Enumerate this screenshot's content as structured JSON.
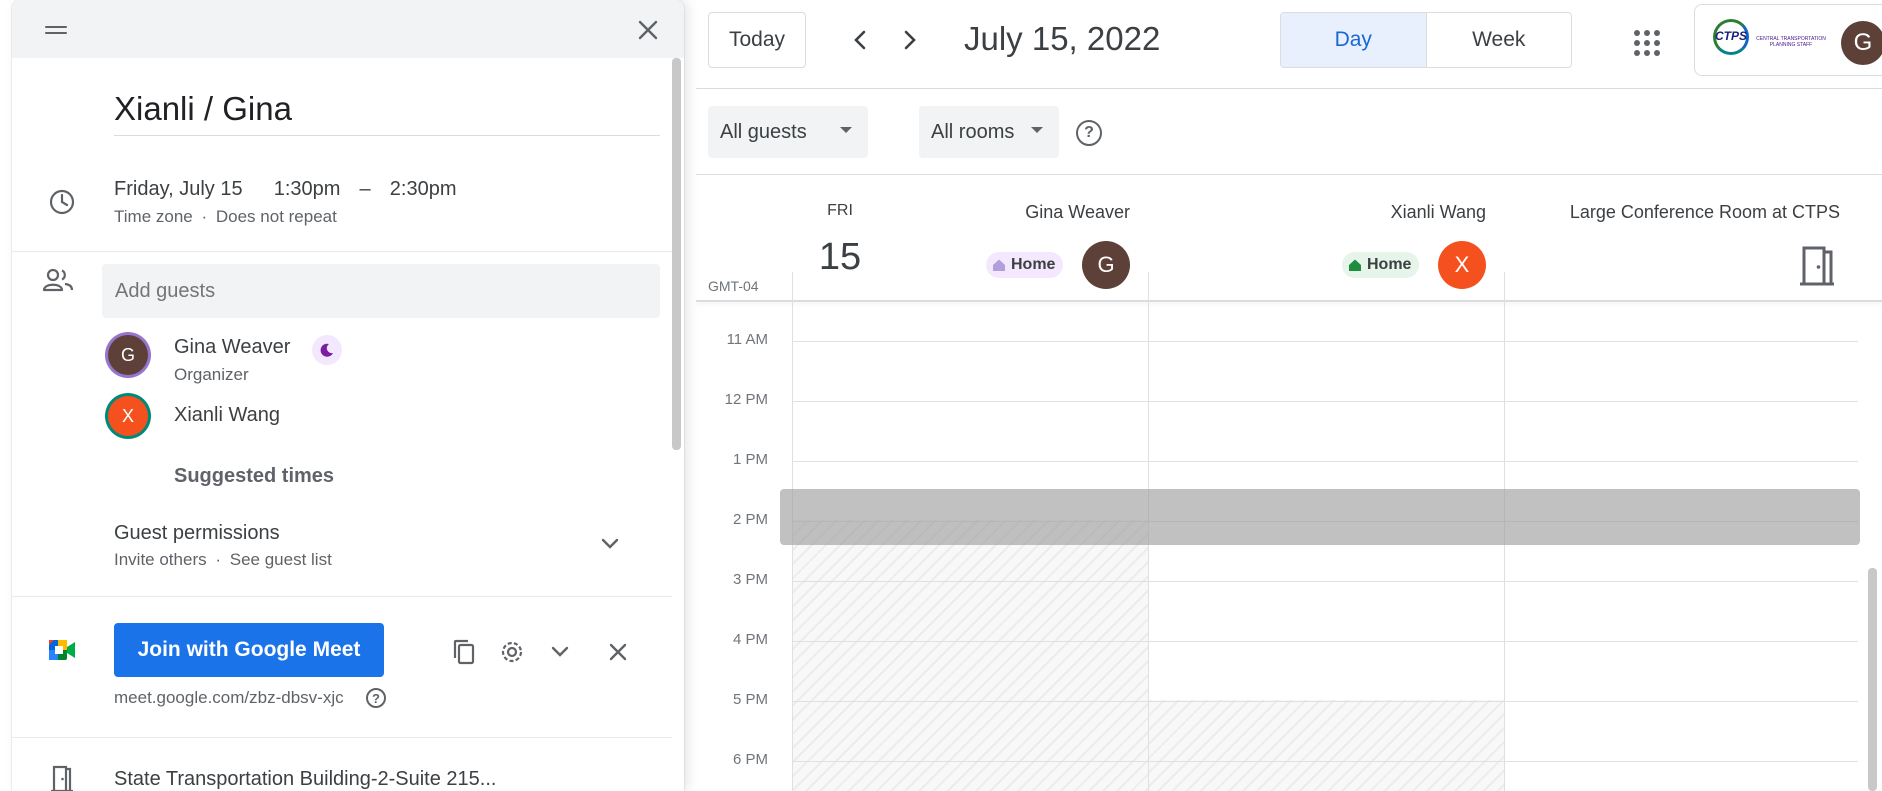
{
  "event": {
    "title": "Xianli / Gina",
    "date": "Friday, July 15",
    "start_time": "1:30pm",
    "dash": "–",
    "end_time": "2:30pm",
    "timezone_label": "Time zone",
    "dot": "·",
    "repeat_label": "Does not repeat",
    "add_guests_placeholder": "Add guests",
    "guests": [
      {
        "initial": "G",
        "name": "Gina Weaver",
        "role": "Organizer",
        "avatar_color": "#5d4037",
        "ring_color": "#9575cd"
      },
      {
        "initial": "X",
        "name": "Xianli Wang",
        "role": "",
        "avatar_color": "#f4511e",
        "ring_color": "#00897b"
      }
    ],
    "suggested_times": "Suggested times",
    "guest_permissions": {
      "title": "Guest permissions",
      "invite_others": "Invite others",
      "see_guest_list": "See guest list"
    },
    "meet": {
      "button_label": "Join with Google Meet",
      "link": "meet.google.com/zbz-dbsv-xjc"
    },
    "location": "State Transportation Building-2-Suite 215..."
  },
  "header": {
    "today_label": "Today",
    "date_title": "July 15, 2022",
    "view_day": "Day",
    "view_week": "Week",
    "account_initial": "G",
    "logo_text": "CTPS",
    "logo_subtext": "CENTRAL TRANSPORTATION PLANNING STAFF"
  },
  "filters": {
    "guests": "All guests",
    "rooms": "All rooms"
  },
  "day_column": {
    "weekday": "FRI",
    "day_number": "15",
    "timezone": "GMT-04"
  },
  "columns": [
    {
      "name": "Gina Weaver",
      "status": "Home",
      "initial": "G",
      "avatar_color": "#5d4037",
      "status_bg": "#f3e8fd",
      "status_icon_color": "#b39ddb"
    },
    {
      "name": "Xianli Wang",
      "status": "Home",
      "initial": "X",
      "avatar_color": "#f4511e",
      "status_bg": "#e6f4ea",
      "status_icon_color": "#1e8e3e"
    },
    {
      "name": "Large Conference Room at CTPS"
    }
  ],
  "hours": [
    "11 AM",
    "12 PM",
    "1 PM",
    "2 PM",
    "3 PM",
    "4 PM",
    "5 PM",
    "6 PM"
  ],
  "colors": {
    "accent": "#1a73e8",
    "day_active_bg": "#e8f0fe",
    "day_active_text": "#1967d2"
  }
}
